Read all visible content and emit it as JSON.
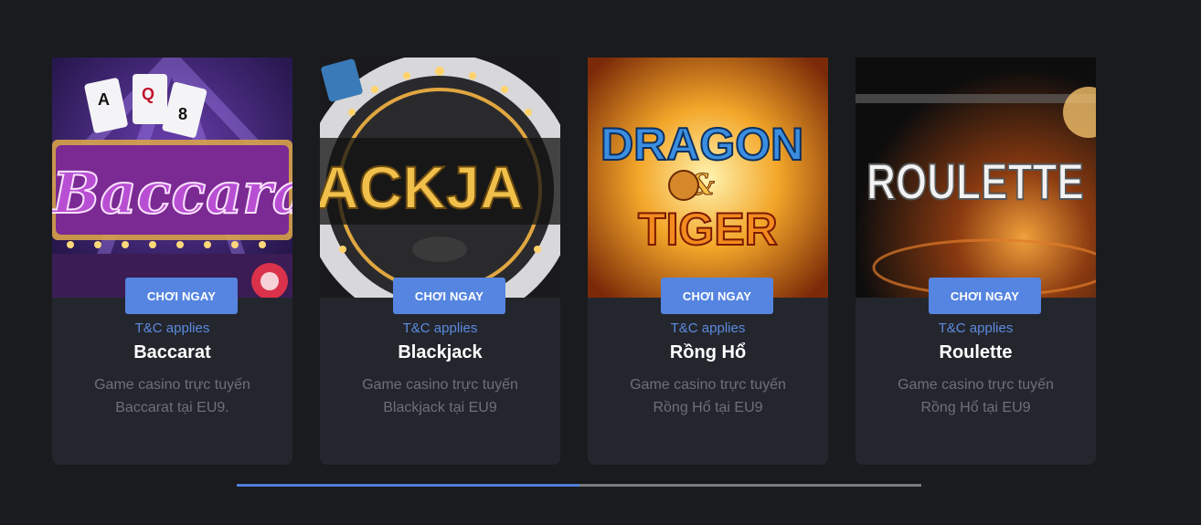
{
  "games": [
    {
      "thumb_icon": "baccarat-thumbnail",
      "thumb_text": "Baccarat",
      "button": "CHƠI NGAY",
      "terms": "T&C applies",
      "title": "Baccarat",
      "desc_line1": "Game casino trực tuyến",
      "desc_line2": "Baccarat tại EU9."
    },
    {
      "thumb_icon": "blackjack-thumbnail",
      "thumb_text": "ACKJA",
      "button": "CHƠI NGAY",
      "terms": "T&C applies",
      "title": "Blackjack",
      "desc_line1": "Game casino trực tuyến",
      "desc_line2": "Blackjack tại EU9"
    },
    {
      "thumb_icon": "dragon-tiger-thumbnail",
      "thumb_text": "DRAGON",
      "thumb_text2": "&",
      "thumb_text3": "TIGER",
      "button": "CHƠI NGAY",
      "terms": "T&C applies",
      "title": "Rồng Hổ",
      "desc_line1": "Game casino trực tuyến",
      "desc_line2": "Rồng Hổ tại EU9"
    },
    {
      "thumb_icon": "roulette-thumbnail",
      "thumb_text": "ROULETTE",
      "button": "CHƠI NGAY",
      "terms": "T&C applies",
      "title": "Roulette",
      "desc_line1": "Game casino trực tuyến",
      "desc_line2": "Rồng Hổ tại EU9"
    }
  ],
  "carousel_progress": 0.5,
  "colors": {
    "accent": "#5585e0",
    "link": "#5b8be0",
    "card_bg": "#24262d",
    "page_bg": "#1a1b1f"
  }
}
